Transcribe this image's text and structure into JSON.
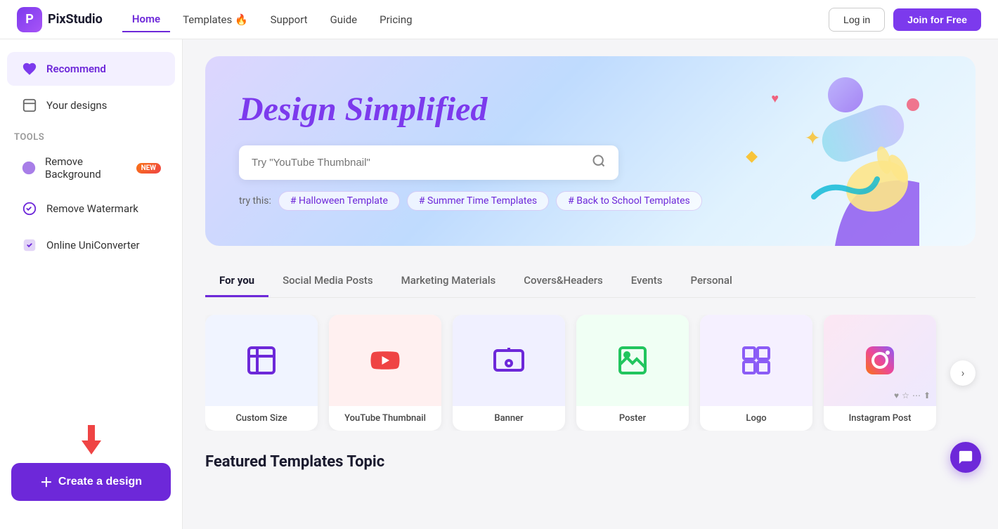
{
  "navbar": {
    "logo_text": "PixStudio",
    "links": [
      {
        "label": "Home",
        "active": true
      },
      {
        "label": "Templates 🔥",
        "active": false
      },
      {
        "label": "Support",
        "active": false
      },
      {
        "label": "Guide",
        "active": false
      },
      {
        "label": "Pricing",
        "active": false
      }
    ],
    "login_label": "Log in",
    "join_label": "Join for Free"
  },
  "sidebar": {
    "recommend_label": "Recommend",
    "your_designs_label": "Your designs",
    "tools_label": "Tools",
    "tools": [
      {
        "label": "Remove Background",
        "new": true
      },
      {
        "label": "Remove Watermark",
        "new": false
      },
      {
        "label": "Online UniConverter",
        "new": false
      }
    ],
    "create_label": "Create a design"
  },
  "hero": {
    "title": "Design Simplified",
    "search_placeholder": "Try \"YouTube Thumbnail\"",
    "try_this_label": "try this:",
    "tags": [
      {
        "label": "# Halloween Template"
      },
      {
        "label": "# Summer Time Templates"
      },
      {
        "label": "# Back to School Templates"
      }
    ]
  },
  "tabs": [
    {
      "label": "For you",
      "active": true
    },
    {
      "label": "Social Media Posts",
      "active": false
    },
    {
      "label": "Marketing Materials",
      "active": false
    },
    {
      "label": "Covers&Headers",
      "active": false
    },
    {
      "label": "Events",
      "active": false
    },
    {
      "label": "Personal",
      "active": false
    }
  ],
  "design_cards": [
    {
      "label": "Custom Size",
      "icon": "⬜",
      "style": "custom"
    },
    {
      "label": "YouTube Thumbnail",
      "icon": "▶",
      "style": "youtube"
    },
    {
      "label": "Banner",
      "icon": "🖼",
      "style": "banner"
    },
    {
      "label": "Poster",
      "icon": "📷",
      "style": "poster"
    },
    {
      "label": "Logo",
      "icon": "⚙",
      "style": "logo"
    },
    {
      "label": "Instagram Post",
      "icon": "📷",
      "style": "instagram"
    }
  ],
  "featured_title": "Featured Templates Topic"
}
